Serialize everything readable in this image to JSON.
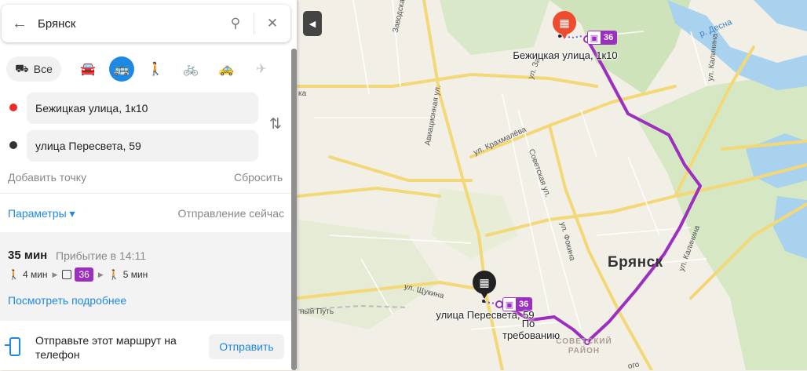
{
  "search": {
    "query": "Брянск"
  },
  "modes": [
    {
      "id": "all",
      "label": "Все",
      "icon": "multi-transport-icon"
    },
    {
      "id": "car",
      "icon": "car-icon"
    },
    {
      "id": "transit",
      "icon": "bus-icon",
      "active": true
    },
    {
      "id": "walk",
      "icon": "pedestrian-icon"
    },
    {
      "id": "bike",
      "icon": "bicycle-icon"
    },
    {
      "id": "taxi",
      "icon": "taxi-icon"
    },
    {
      "id": "plane",
      "icon": "plane-icon",
      "disabled": true
    }
  ],
  "route": {
    "from": "Бежицкая улица, 1к10",
    "to": "улица Пересвета, 59",
    "from_color": "#ee2b2b",
    "to_color": "#333333"
  },
  "actions": {
    "add_point": "Добавить точку",
    "reset": "Сбросить"
  },
  "params": {
    "label": "Параметры ▾",
    "departure": "Отправление сейчас"
  },
  "result": {
    "duration": "35 мин",
    "arrival": "Прибытие в 14:11",
    "walk_start": "4 мин",
    "bus": "36",
    "walk_end": "5 мин",
    "details_link": "Посмотреть подробнее"
  },
  "send": {
    "text": "Отправьте этот маршрут на телефон",
    "button": "Отправить"
  },
  "map": {
    "city": "Брянск",
    "district": "СОВЕТСКИЙ РАЙОН",
    "river": "р. Десна",
    "start_label": "Бежицкая улица, 1к10",
    "end_label": "улица Пересвета, 59",
    "bus_badge": "36",
    "on_request": "По требованию",
    "route_color": "#9c2fbf",
    "streets": [
      "ул. Калинина",
      "ул. Калинина",
      "ул. Крахмалёва",
      "Авиационная ул.",
      "Советская ул.",
      "ул. Фокина",
      "ул. Щукина",
      "ный Путь",
      "ул. За",
      "Заводская ул.",
      "ка",
      "ого"
    ]
  }
}
